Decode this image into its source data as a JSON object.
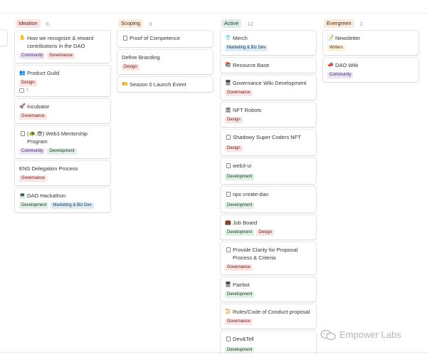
{
  "columns": [
    {
      "title": "Ideation",
      "count": "6",
      "bg": "#fbe4e4",
      "fg": "#5d1715",
      "cards": [
        {
          "icon": "✋",
          "icon_name": "raised-hand-icon",
          "title": "How we recognize & reward contributions in the DAO",
          "tags": [
            {
              "label": "Community",
              "kind": "community"
            },
            {
              "label": "Governance",
              "kind": "governance"
            }
          ]
        },
        {
          "icon": "👥",
          "icon_name": "people-icon",
          "title": "Product Guild",
          "tags": [
            {
              "label": "Design",
              "kind": "design"
            }
          ],
          "comment": "1"
        },
        {
          "icon": "🚀",
          "icon_name": "rocket-icon",
          "title": "Incubator",
          "tags": [
            {
              "label": "Governance",
              "kind": "governance"
            }
          ]
        },
        {
          "icon": "doc",
          "icon_name": "document-icon",
          "title": "(🐢,😎) Web3 Mentorship Program",
          "tags": [
            {
              "label": "Community",
              "kind": "community"
            },
            {
              "label": "Development",
              "kind": "development"
            }
          ]
        },
        {
          "icon": "",
          "icon_name": "",
          "title": "ENS Delegation Process",
          "tags": [
            {
              "label": "Governance",
              "kind": "governance"
            }
          ]
        },
        {
          "icon": "💻",
          "icon_name": "laptop-icon",
          "title": "DAO Hackathon",
          "tags": [
            {
              "label": "Development",
              "kind": "development"
            },
            {
              "label": "Marketing & Biz Dev",
              "kind": "marketing"
            }
          ]
        }
      ]
    },
    {
      "title": "Scoping",
      "count": "3",
      "bg": "#faebdd",
      "fg": "#49290e",
      "cards": [
        {
          "icon": "doc",
          "icon_name": "document-icon",
          "title": "Proof of Competence",
          "tags": []
        },
        {
          "icon": "",
          "icon_name": "",
          "title": "Define Branding",
          "tags": [
            {
              "label": "Design",
              "kind": "design"
            }
          ]
        },
        {
          "icon": "🎫",
          "icon_name": "ticket-icon",
          "title": "Season 0 Launch Event",
          "tags": []
        }
      ]
    },
    {
      "title": "Active",
      "count": "12",
      "bg": "#ddedea",
      "fg": "#1c3829",
      "cards": [
        {
          "icon": "👕",
          "icon_name": "tshirt-icon",
          "title": "Merch",
          "tags": [
            {
              "label": "Marketing & Biz Dev",
              "kind": "marketing"
            }
          ]
        },
        {
          "icon": "📚",
          "icon_name": "books-icon",
          "title": "Resource Base",
          "tags": []
        },
        {
          "icon": "🖥",
          "icon_name": "desktop-icon",
          "title": "Governance Wiki Development",
          "tags": [
            {
              "label": "Governance",
              "kind": "governance"
            }
          ]
        },
        {
          "icon": "🏛",
          "icon_name": "bank-icon",
          "title": "NFT Robots",
          "tags": [
            {
              "label": "Design",
              "kind": "design"
            }
          ]
        },
        {
          "icon": "doc",
          "icon_name": "document-icon",
          "title": "Shadowy Super Coders NFT",
          "tags": [
            {
              "label": "Design",
              "kind": "design"
            }
          ]
        },
        {
          "icon": "doc",
          "icon_name": "document-icon",
          "title": "web3-ui",
          "tags": [
            {
              "label": "Development",
              "kind": "development"
            }
          ]
        },
        {
          "icon": "doc",
          "icon_name": "document-icon",
          "title": "npx create-dao",
          "tags": [
            {
              "label": "Development",
              "kind": "development"
            }
          ]
        },
        {
          "icon": "💼",
          "icon_name": "briefcase-icon",
          "title": "Job Board",
          "tags": [
            {
              "label": "Development",
              "kind": "development"
            },
            {
              "label": "Design",
              "kind": "design"
            }
          ]
        },
        {
          "icon": "doc",
          "icon_name": "document-icon",
          "title": "Provide Clarity for Proposal Process & Criteria",
          "tags": [
            {
              "label": "Governance",
              "kind": "governance"
            }
          ]
        },
        {
          "icon": "🖥",
          "icon_name": "desktop-icon",
          "title": "Pairbot",
          "tags": [
            {
              "label": "Development",
              "kind": "development"
            }
          ]
        },
        {
          "icon": "📜",
          "icon_name": "scroll-icon",
          "title": "Rules/Code of Conduct proposal",
          "tags": [
            {
              "label": "Governance",
              "kind": "governance"
            }
          ]
        },
        {
          "icon": "doc",
          "icon_name": "document-icon",
          "title": "Dev&Tell",
          "tags": [
            {
              "label": "Development",
              "kind": "development"
            }
          ]
        }
      ]
    },
    {
      "title": "Evergreen",
      "count": "2",
      "bg": "#faebdd",
      "fg": "#49290e",
      "cards": [
        {
          "icon": "📝",
          "icon_name": "memo-icon",
          "title": "Newsletter",
          "tags": [
            {
              "label": "Writers",
              "kind": "writers"
            }
          ]
        },
        {
          "icon": "📣",
          "icon_name": "megaphone-icon",
          "title": "DAO Wiki",
          "tags": [
            {
              "label": "Community",
              "kind": "community"
            }
          ]
        }
      ]
    }
  ],
  "watermark": "Empower Labs"
}
